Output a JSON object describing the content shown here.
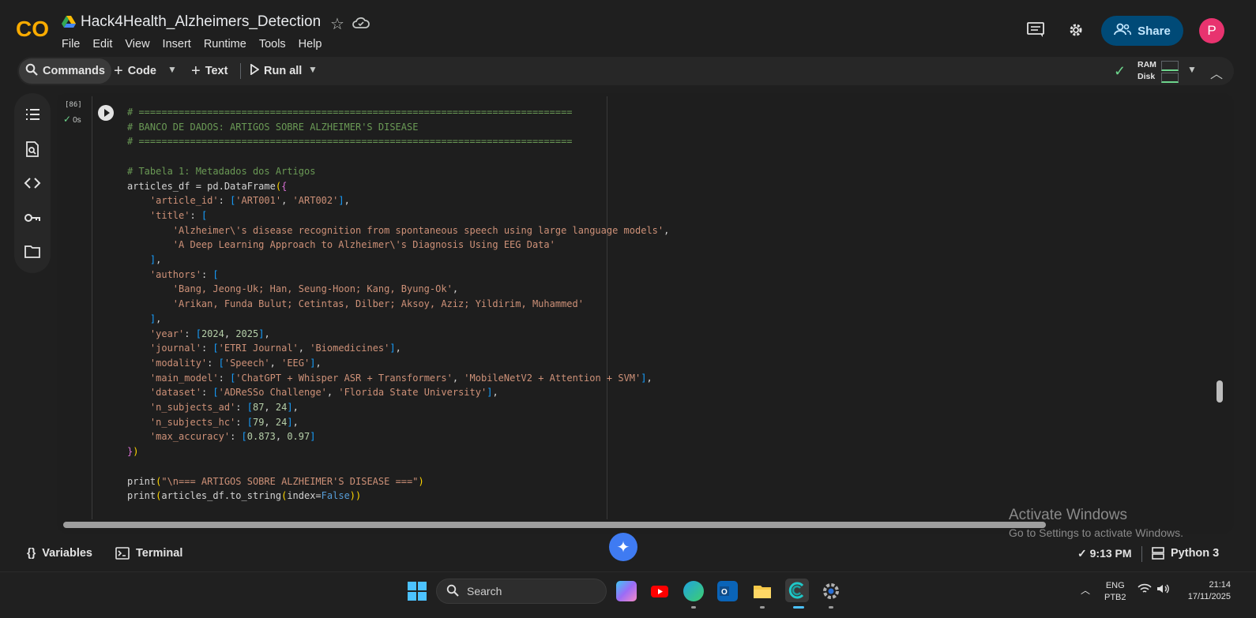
{
  "app": {
    "logo_text": "CO",
    "title": "Hack4Health_Alzheimers_Detection",
    "menu": [
      "File",
      "Edit",
      "View",
      "Insert",
      "Runtime",
      "Tools",
      "Help"
    ],
    "share_label": "Share",
    "avatar_initial": "P"
  },
  "toolbar": {
    "commands_label": "Commands",
    "code_label": "Code",
    "text_label": "Text",
    "runall_label": "Run all",
    "ram_label": "RAM",
    "disk_label": "Disk"
  },
  "cell": {
    "exec_count": "[86]",
    "exec_time": "0s",
    "code_lines": [
      "# ============================================================================",
      "# BANCO DE DADOS: ARTIGOS SOBRE ALZHEIMER'S DISEASE",
      "# ============================================================================",
      "",
      "# Tabela 1: Metadados dos Artigos",
      "articles_df = pd.DataFrame({",
      "    'article_id': ['ART001', 'ART002'],",
      "    'title': [",
      "        'Alzheimer\\'s disease recognition from spontaneous speech using large language models',",
      "        'A Deep Learning Approach to Alzheimer\\'s Diagnosis Using EEG Data'",
      "    ],",
      "    'authors': [",
      "        'Bang, Jeong-Uk; Han, Seung-Hoon; Kang, Byung-Ok',",
      "        'Arikan, Funda Bulut; Cetintas, Dilber; Aksoy, Aziz; Yildirim, Muhammed'",
      "    ],",
      "    'year': [2024, 2025],",
      "    'journal': ['ETRI Journal', 'Biomedicines'],",
      "    'modality': ['Speech', 'EEG'],",
      "    'main_model': ['ChatGPT + Whisper ASR + Transformers', 'MobileNetV2 + Attention + SVM'],",
      "    'dataset': ['ADReSSo Challenge', 'Florida State University'],",
      "    'n_subjects_ad': [87, 24],",
      "    'n_subjects_hc': [79, 24],",
      "    'max_accuracy': [0.873, 0.97]",
      "})",
      "",
      "print(\"\\n=== ARTIGOS SOBRE ALZHEIMER'S DISEASE ===\")",
      "print(articles_df.to_string(index=False))"
    ]
  },
  "watermark": {
    "line1": "Activate Windows",
    "line2": "Go to Settings to activate Windows."
  },
  "statusbar": {
    "variables_label": "Variables",
    "terminal_label": "Terminal",
    "time": "9:13 PM",
    "kernel": "Python 3"
  },
  "taskbar": {
    "search_placeholder": "Search",
    "lang_line1": "ENG",
    "lang_line2": "PTB2",
    "clock_time": "21:14",
    "clock_date": "17/11/2025"
  },
  "colors": {
    "accent": "#004a77",
    "avatar": "#e8336f",
    "ok_green": "#6dd58c",
    "gemini": "#3f7bf2"
  }
}
